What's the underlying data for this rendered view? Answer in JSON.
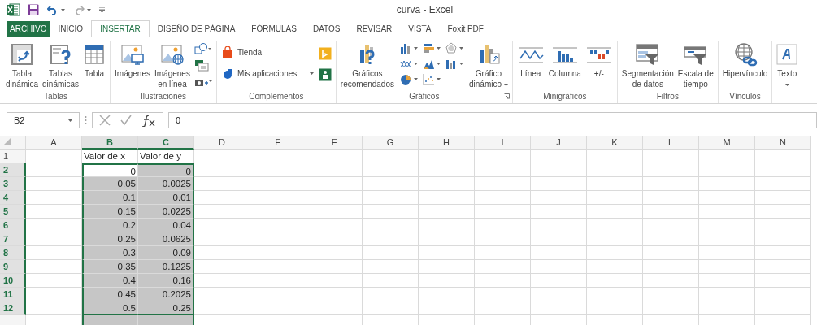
{
  "window": {
    "title": "curva - Excel"
  },
  "tabs": [
    {
      "label": "ARCHIVO",
      "kind": "file",
      "selected": false
    },
    {
      "label": "INICIO",
      "kind": "tab",
      "selected": false
    },
    {
      "label": "INSERTAR",
      "kind": "tab",
      "selected": true
    },
    {
      "label": "DISEÑO DE PÁGINA",
      "kind": "tab",
      "selected": false
    },
    {
      "label": "FÓRMULAS",
      "kind": "tab",
      "selected": false
    },
    {
      "label": "DATOS",
      "kind": "tab",
      "selected": false
    },
    {
      "label": "REVISAR",
      "kind": "tab",
      "selected": false
    },
    {
      "label": "VISTA",
      "kind": "tab",
      "selected": false
    },
    {
      "label": "Foxit PDF",
      "kind": "tab",
      "selected": false
    }
  ],
  "ribbon": [
    {
      "label": "Tablas",
      "items": [
        {
          "kind": "large",
          "label": "Tabla\ndinámica"
        },
        {
          "kind": "large",
          "label": "Tablas\ndinámicas"
        },
        {
          "kind": "large",
          "label": "Tabla"
        }
      ]
    },
    {
      "label": "Ilustraciones",
      "items": [
        {
          "kind": "large",
          "label": "Imágenes"
        },
        {
          "kind": "large",
          "label": "Imágenes\nen línea"
        },
        {
          "kind": "stack"
        }
      ]
    },
    {
      "label": "Complementos",
      "items": [
        {
          "kind": "small",
          "label": "Tienda"
        },
        {
          "kind": "small",
          "label": "Mis aplicaciones",
          "dropdown": true
        },
        {
          "kind": "stack"
        }
      ]
    },
    {
      "label": "Gráficos",
      "launcher": true,
      "items": [
        {
          "kind": "large",
          "label": "Gráficos\nrecomendados"
        },
        {
          "kind": "stack"
        },
        {
          "kind": "large",
          "label": "Gráfico\ndinámico",
          "dropdown": true
        }
      ]
    },
    {
      "label": "Minigráficos",
      "items": [
        {
          "kind": "large",
          "label": "Línea"
        },
        {
          "kind": "large",
          "label": "Columna"
        },
        {
          "kind": "large",
          "label": "+/-"
        }
      ]
    },
    {
      "label": "Filtros",
      "items": [
        {
          "kind": "large",
          "label": "Segmentación\nde datos"
        },
        {
          "kind": "large",
          "label": "Escala de\ntiempo"
        }
      ]
    },
    {
      "label": "Vínculos",
      "items": [
        {
          "kind": "large",
          "label": "Hipervínculo"
        }
      ]
    },
    {
      "items": [
        {
          "kind": "large",
          "label": "Texto",
          "dropdown": true
        }
      ]
    }
  ],
  "formula_bar": {
    "name_box": "B2",
    "value": "0"
  },
  "grid": {
    "columns": [
      {
        "label": "A",
        "selected": false
      },
      {
        "label": "B",
        "selected": true
      },
      {
        "label": "C",
        "selected": true
      },
      {
        "label": "D",
        "selected": false
      },
      {
        "label": "E",
        "selected": false
      },
      {
        "label": "F",
        "selected": false
      },
      {
        "label": "G",
        "selected": false
      },
      {
        "label": "H",
        "selected": false
      },
      {
        "label": "I",
        "selected": false
      },
      {
        "label": "J",
        "selected": false
      },
      {
        "label": "K",
        "selected": false
      },
      {
        "label": "L",
        "selected": false
      },
      {
        "label": "M",
        "selected": false
      },
      {
        "label": "N",
        "selected": false
      }
    ],
    "rows": [
      {
        "number": "1",
        "selected": false,
        "b": {
          "text": "Valor de x",
          "kind": "text",
          "selected": false
        },
        "c": {
          "text": "Valor de y",
          "kind": "text",
          "selected": false
        }
      },
      {
        "number": "2",
        "selected": true,
        "b": {
          "text": "0",
          "selected": true,
          "active": true
        },
        "c": {
          "text": "0",
          "selected": true
        }
      },
      {
        "number": "3",
        "selected": true,
        "b": {
          "text": "0.05",
          "selected": true
        },
        "c": {
          "text": "0.0025",
          "selected": true
        }
      },
      {
        "number": "4",
        "selected": true,
        "b": {
          "text": "0.1",
          "selected": true
        },
        "c": {
          "text": "0.01",
          "selected": true
        }
      },
      {
        "number": "5",
        "selected": true,
        "b": {
          "text": "0.15",
          "selected": true
        },
        "c": {
          "text": "0.0225",
          "selected": true
        }
      },
      {
        "number": "6",
        "selected": true,
        "b": {
          "text": "0.2",
          "selected": true
        },
        "c": {
          "text": "0.04",
          "selected": true
        }
      },
      {
        "number": "7",
        "selected": true,
        "b": {
          "text": "0.25",
          "selected": true
        },
        "c": {
          "text": "0.0625",
          "selected": true
        }
      },
      {
        "number": "8",
        "selected": true,
        "b": {
          "text": "0.3",
          "selected": true
        },
        "c": {
          "text": "0.09",
          "selected": true
        }
      },
      {
        "number": "9",
        "selected": true,
        "b": {
          "text": "0.35",
          "selected": true
        },
        "c": {
          "text": "0.1225",
          "selected": true
        }
      },
      {
        "number": "10",
        "selected": true,
        "b": {
          "text": "0.4",
          "selected": true
        },
        "c": {
          "text": "0.16",
          "selected": true
        }
      },
      {
        "number": "11",
        "selected": true,
        "b": {
          "text": "0.45",
          "selected": true
        },
        "c": {
          "text": "0.2025",
          "selected": true
        }
      },
      {
        "number": "12",
        "selected": true,
        "b": {
          "text": "0.5",
          "selected": true
        },
        "c": {
          "text": "0.25",
          "selected": true
        }
      }
    ]
  }
}
